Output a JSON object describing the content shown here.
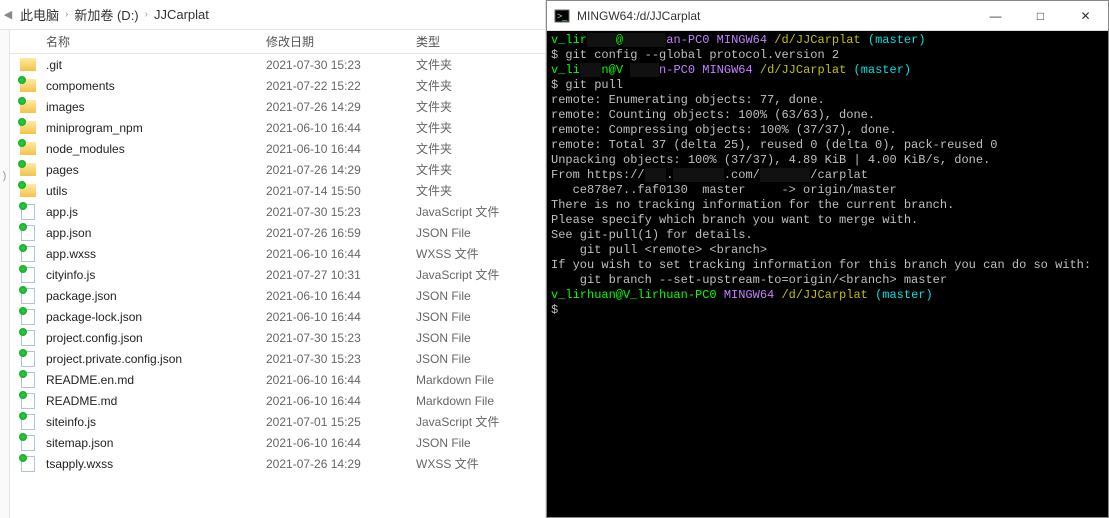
{
  "explorer": {
    "breadcrumb": [
      "此电脑",
      "新加卷 (D:)",
      "JJCarplat"
    ],
    "strip_label": ")",
    "columns": {
      "name": "名称",
      "date": "修改日期",
      "type": "类型"
    },
    "rows": [
      {
        "icon": "folder-plain",
        "name": ".git",
        "date": "2021-07-30 15:23",
        "type": "文件夹"
      },
      {
        "icon": "folder-green",
        "name": "compoments",
        "date": "2021-07-22 15:22",
        "type": "文件夹"
      },
      {
        "icon": "folder-green",
        "name": "images",
        "date": "2021-07-26 14:29",
        "type": "文件夹"
      },
      {
        "icon": "folder-green",
        "name": "miniprogram_npm",
        "date": "2021-06-10 16:44",
        "type": "文件夹"
      },
      {
        "icon": "folder-green",
        "name": "node_modules",
        "date": "2021-06-10 16:44",
        "type": "文件夹"
      },
      {
        "icon": "folder-green",
        "name": "pages",
        "date": "2021-07-26 14:29",
        "type": "文件夹"
      },
      {
        "icon": "folder-green",
        "name": "utils",
        "date": "2021-07-14 15:50",
        "type": "文件夹"
      },
      {
        "icon": "file-green",
        "name": "app.js",
        "date": "2021-07-30 15:23",
        "type": "JavaScript 文件"
      },
      {
        "icon": "file-green",
        "name": "app.json",
        "date": "2021-07-26 16:59",
        "type": "JSON File"
      },
      {
        "icon": "file-green",
        "name": "app.wxss",
        "date": "2021-06-10 16:44",
        "type": "WXSS 文件"
      },
      {
        "icon": "file-green",
        "name": "cityinfo.js",
        "date": "2021-07-27 10:31",
        "type": "JavaScript 文件"
      },
      {
        "icon": "file-green",
        "name": "package.json",
        "date": "2021-06-10 16:44",
        "type": "JSON File"
      },
      {
        "icon": "file-green",
        "name": "package-lock.json",
        "date": "2021-06-10 16:44",
        "type": "JSON File"
      },
      {
        "icon": "file-green",
        "name": "project.config.json",
        "date": "2021-07-30 15:23",
        "type": "JSON File"
      },
      {
        "icon": "file-green",
        "name": "project.private.config.json",
        "date": "2021-07-30 15:23",
        "type": "JSON File"
      },
      {
        "icon": "file-green",
        "name": "README.en.md",
        "date": "2021-06-10 16:44",
        "type": "Markdown File"
      },
      {
        "icon": "file-green",
        "name": "README.md",
        "date": "2021-06-10 16:44",
        "type": "Markdown File"
      },
      {
        "icon": "file-green",
        "name": "siteinfo.js",
        "date": "2021-07-01 15:25",
        "type": "JavaScript 文件"
      },
      {
        "icon": "file-green",
        "name": "sitemap.json",
        "date": "2021-06-10 16:44",
        "type": "JSON File"
      },
      {
        "icon": "file-green",
        "name": "tsapply.wxss",
        "date": "2021-07-26 14:29",
        "type": "WXSS 文件"
      }
    ]
  },
  "terminal": {
    "title": "MINGW64:/d/JJCarplat",
    "icon": "terminal-icon",
    "lines": [
      [
        {
          "c": "c-green",
          "t": "v_lir"
        },
        {
          "c": "c-dim",
          "t": "    "
        },
        {
          "c": "c-green",
          "t": "@"
        },
        {
          "c": "c-dim",
          "t": "      "
        },
        {
          "c": "c-purple",
          "t": "an-PC0 "
        },
        {
          "c": "c-purple",
          "t": "MINGW64 "
        },
        {
          "c": "c-yellow",
          "t": "/d/JJCarplat "
        },
        {
          "c": "c-cyan",
          "t": "(master)"
        }
      ],
      [
        {
          "c": "",
          "t": "$ git config --global protocol.version 2"
        }
      ],
      [
        {
          "c": "",
          "t": ""
        }
      ],
      [
        {
          "c": "c-green",
          "t": "v_li"
        },
        {
          "c": "c-dim",
          "t": "   "
        },
        {
          "c": "c-green",
          "t": "n@V "
        },
        {
          "c": "c-dim",
          "t": "    "
        },
        {
          "c": "c-purple",
          "t": "n-PC0 "
        },
        {
          "c": "c-purple",
          "t": "MINGW64 "
        },
        {
          "c": "c-yellow",
          "t": "/d/JJCarplat "
        },
        {
          "c": "c-cyan",
          "t": "(master)"
        }
      ],
      [
        {
          "c": "",
          "t": "$ git pull"
        }
      ],
      [
        {
          "c": "",
          "t": "remote: Enumerating objects: 77, done."
        }
      ],
      [
        {
          "c": "",
          "t": "remote: Counting objects: 100% (63/63), done."
        }
      ],
      [
        {
          "c": "",
          "t": "remote: Compressing objects: 100% (37/37), done."
        }
      ],
      [
        {
          "c": "",
          "t": "remote: Total 37 (delta 25), reused 0 (delta 0), pack-reused 0"
        }
      ],
      [
        {
          "c": "",
          "t": "Unpacking objects: 100% (37/37), 4.89 KiB | 4.00 KiB/s, done."
        }
      ],
      [
        {
          "c": "",
          "t": "From https://"
        },
        {
          "c": "c-dim",
          "t": "   "
        },
        {
          "c": "",
          "t": "."
        },
        {
          "c": "c-dim",
          "t": "       "
        },
        {
          "c": "",
          "t": ".com/"
        },
        {
          "c": "c-dim",
          "t": "       "
        },
        {
          "c": "",
          "t": "/carplat"
        }
      ],
      [
        {
          "c": "",
          "t": "   ce878e7..faf0130  master     -> origin/master"
        }
      ],
      [
        {
          "c": "",
          "t": "There is no tracking information for the current branch."
        }
      ],
      [
        {
          "c": "",
          "t": "Please specify which branch you want to merge with."
        }
      ],
      [
        {
          "c": "",
          "t": "See git-pull(1) for details."
        }
      ],
      [
        {
          "c": "",
          "t": ""
        }
      ],
      [
        {
          "c": "",
          "t": "    git pull <remote> <branch>"
        }
      ],
      [
        {
          "c": "",
          "t": ""
        }
      ],
      [
        {
          "c": "",
          "t": "If you wish to set tracking information for this branch you can do so with:"
        }
      ],
      [
        {
          "c": "",
          "t": ""
        }
      ],
      [
        {
          "c": "",
          "t": "    git branch --set-upstream-to=origin/<branch> master"
        }
      ],
      [
        {
          "c": "",
          "t": ""
        }
      ],
      [
        {
          "c": "",
          "t": ""
        }
      ],
      [
        {
          "c": "c-green",
          "t": "v_lirhuan@V_lirhuan-PC0 "
        },
        {
          "c": "c-purple",
          "t": "MINGW64 "
        },
        {
          "c": "c-yellow",
          "t": "/d/JJCarplat "
        },
        {
          "c": "c-cyan",
          "t": "(master)"
        }
      ],
      [
        {
          "c": "",
          "t": "$"
        }
      ]
    ]
  },
  "winbtns": {
    "min": "—",
    "max": "□",
    "close": "✕"
  }
}
